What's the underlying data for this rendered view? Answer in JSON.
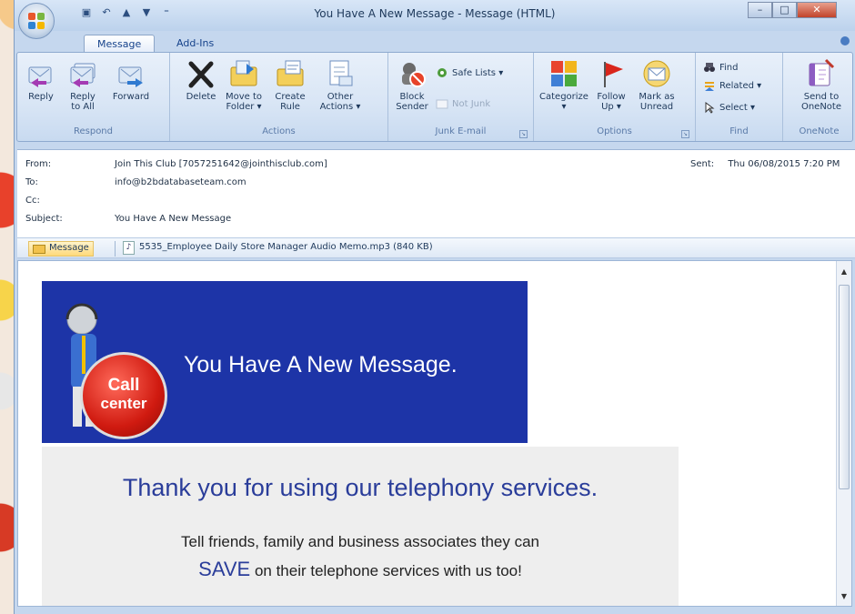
{
  "window": {
    "title": "You Have A New Message - Message (HTML)"
  },
  "tabs": [
    {
      "label": "Message",
      "active": true
    },
    {
      "label": "Add-Ins",
      "active": false
    }
  ],
  "ribbon": {
    "respond": {
      "label": "Respond",
      "reply": "Reply",
      "reply_all_1": "Reply",
      "reply_all_2": "to All",
      "forward": "Forward"
    },
    "actions": {
      "label": "Actions",
      "delete": "Delete",
      "move_1": "Move to",
      "move_2": "Folder ▾",
      "rule_1": "Create",
      "rule_2": "Rule",
      "other_1": "Other",
      "other_2": "Actions ▾"
    },
    "junk": {
      "label": "Junk E-mail",
      "block_1": "Block",
      "block_2": "Sender",
      "safe_lists": "Safe Lists ▾",
      "not_junk": "Not Junk"
    },
    "options": {
      "label": "Options",
      "categorize": "Categorize",
      "follow_1": "Follow",
      "follow_2": "Up ▾",
      "mark_1": "Mark as",
      "mark_2": "Unread"
    },
    "find": {
      "label": "Find",
      "find": "Find",
      "related": "Related ▾",
      "select": "Select ▾"
    },
    "onenote": {
      "label": "OneNote",
      "send_1": "Send to",
      "send_2": "OneNote"
    }
  },
  "headers": {
    "from_label": "From:",
    "from_value": "Join This Club [7057251642@jointhisclub.com]",
    "to_label": "To:",
    "to_value": "info@b2bdatabaseteam.com",
    "cc_label": "Cc:",
    "subject_label": "Subject:",
    "subject_value": "You Have A New Message",
    "sent_label": "Sent:",
    "sent_value": "Thu 06/08/2015 7:20 PM"
  },
  "attachments": {
    "message_tab": "Message",
    "file": "5535_Employee Daily Store Manager Audio Memo.mp3 (840 KB)"
  },
  "body": {
    "banner_text": "You Have A New Message.",
    "badge_line1": "Call",
    "badge_line2": "center",
    "thank_you": "Thank you for using our telephony services.",
    "tell_line": "Tell friends, family and business associates they can",
    "save_word": "SAVE",
    "save_rest": " on their telephone services with us too!"
  },
  "colors": {
    "banner_bg": "#1d34a7",
    "accent_text": "#2a3d9a"
  }
}
